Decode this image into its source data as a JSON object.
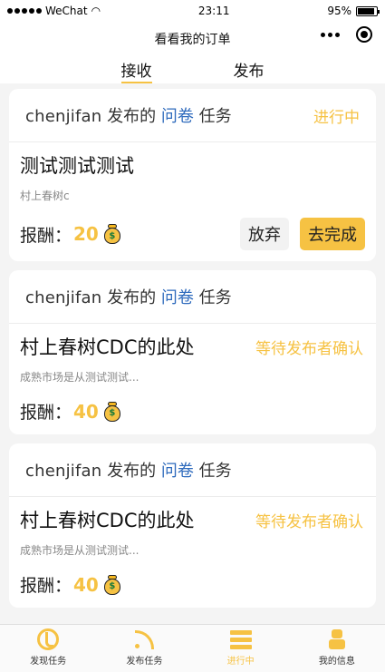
{
  "status_bar": {
    "carrier": "WeChat",
    "time": "23:11",
    "battery": "95%"
  },
  "nav": {
    "title": "看看我的订单"
  },
  "tabs": [
    {
      "label": "接收",
      "active": true
    },
    {
      "label": "发布",
      "active": false
    }
  ],
  "cards": [
    {
      "publisher": "chenjifan",
      "published_label": "发布的",
      "task_type": "问卷",
      "task_word": "任务",
      "head_status": "进行中",
      "title": "测试测试测试",
      "body_status": "",
      "description": "村上春树c",
      "reward_label": "报酬：",
      "reward": "20",
      "actions": {
        "abandon": "放弃",
        "complete": "去完成"
      }
    },
    {
      "publisher": "chenjifan",
      "published_label": "发布的",
      "task_type": "问卷",
      "task_word": "任务",
      "head_status": "",
      "title": "村上春树CDC的此处",
      "body_status": "等待发布者确认",
      "description": "成熟市场是从测试测试...",
      "reward_label": "报酬：",
      "reward": "40"
    },
    {
      "publisher": "chenjifan",
      "published_label": "发布的",
      "task_type": "问卷",
      "task_word": "任务",
      "head_status": "",
      "title": "村上春树CDC的此处",
      "body_status": "等待发布者确认",
      "description": "成熟市场是从测试测试...",
      "reward_label": "报酬：",
      "reward": "40"
    }
  ],
  "tabbar": [
    {
      "label": "发现任务",
      "icon": "discover-icon",
      "active": false
    },
    {
      "label": "发布任务",
      "icon": "publish-icon",
      "active": false
    },
    {
      "label": "进行中",
      "icon": "ongoing-icon",
      "active": true
    },
    {
      "label": "我的信息",
      "icon": "profile-icon",
      "active": false
    }
  ],
  "colors": {
    "accent": "#f6c243",
    "link": "#2f6bbd"
  }
}
